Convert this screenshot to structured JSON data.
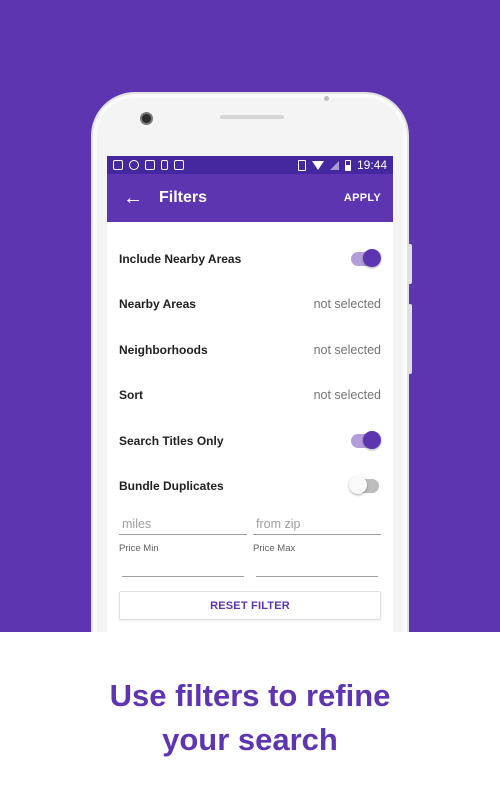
{
  "colors": {
    "brand": "#5e35b1",
    "brand_dark": "#4527a0",
    "toggle_track_on": "#b39ddb"
  },
  "status_bar": {
    "icons": [
      "image-icon",
      "block-icon",
      "vpn-icon",
      "phone-icon",
      "close-box-icon",
      "vibrate-icon",
      "wifi-icon",
      "signal-icon",
      "battery-icon"
    ],
    "time": "19:44"
  },
  "app_bar": {
    "back_icon": "arrow-left-icon",
    "title": "Filters",
    "apply_label": "APPLY"
  },
  "filters": {
    "include_nearby": {
      "label": "Include Nearby Areas",
      "enabled": true
    },
    "nearby_areas": {
      "label": "Nearby Areas",
      "value": "not selected"
    },
    "neighborhoods": {
      "label": "Neighborhoods",
      "value": "not selected"
    },
    "sort": {
      "label": "Sort",
      "value": "not selected"
    },
    "search_titles_only": {
      "label": "Search Titles Only",
      "enabled": true
    },
    "bundle_duplicates": {
      "label": "Bundle Duplicates",
      "enabled": false
    }
  },
  "distance": {
    "miles_placeholder": "miles",
    "zip_placeholder": "from zip"
  },
  "price": {
    "min_label": "Price Min",
    "max_label": "Price Max"
  },
  "reset_label": "RESET FILTER",
  "promo": {
    "line1": "Use filters to refine",
    "line2": "your search"
  }
}
